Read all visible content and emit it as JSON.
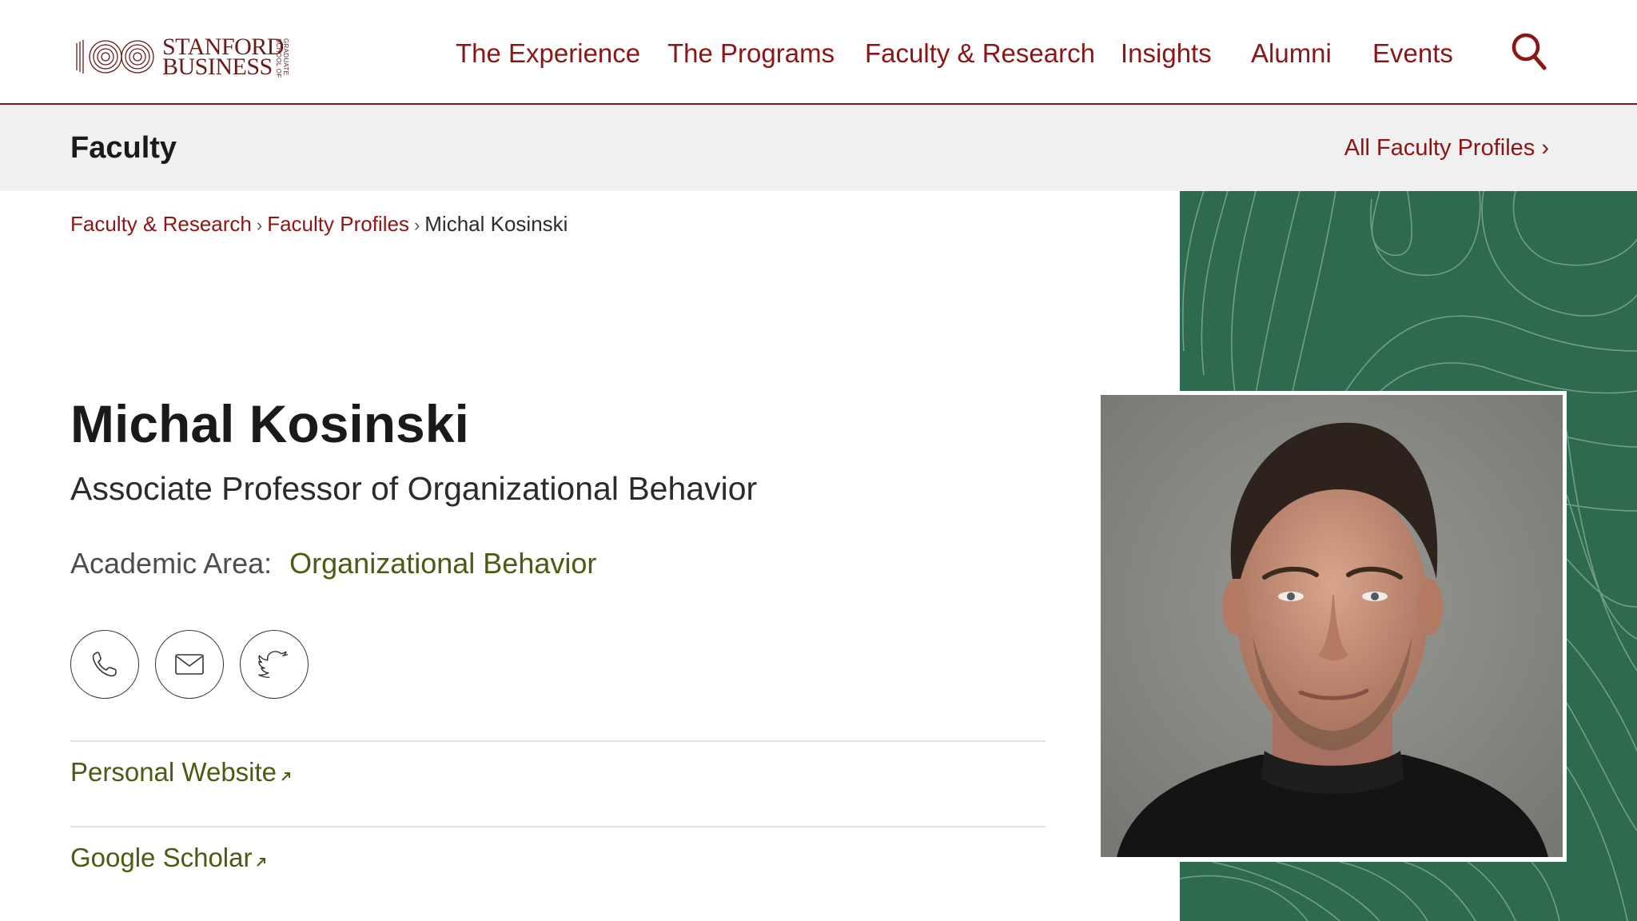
{
  "header": {
    "logo": {
      "line1": "STANFORD",
      "line2": "BUSINESS",
      "small": "GRADUATE SCHOOL OF"
    },
    "nav": [
      "The Experience",
      "The Programs",
      "Faculty & Research",
      "Insights",
      "Alumni",
      "Events"
    ],
    "search_icon": "search-icon"
  },
  "subbar": {
    "title": "Faculty",
    "link": "All Faculty Profiles ›"
  },
  "breadcrumb": {
    "items": [
      "Faculty & Research",
      "Faculty Profiles"
    ],
    "separator": "›",
    "current": "Michal Kosinski"
  },
  "profile": {
    "name": "Michal Kosinski",
    "title": "Associate Professor of Organizational Behavior",
    "area_label": "Academic Area:",
    "area_value": "Organizational Behavior",
    "contact_icons": [
      "phone-icon",
      "email-icon",
      "twitter-icon"
    ],
    "links": [
      "Personal Website",
      "Google Scholar"
    ]
  },
  "colors": {
    "brand": "#8c1515",
    "link_green": "#4a5c12",
    "panel_green": "#2e6a4e",
    "subbar_bg": "#f0f0f0"
  }
}
